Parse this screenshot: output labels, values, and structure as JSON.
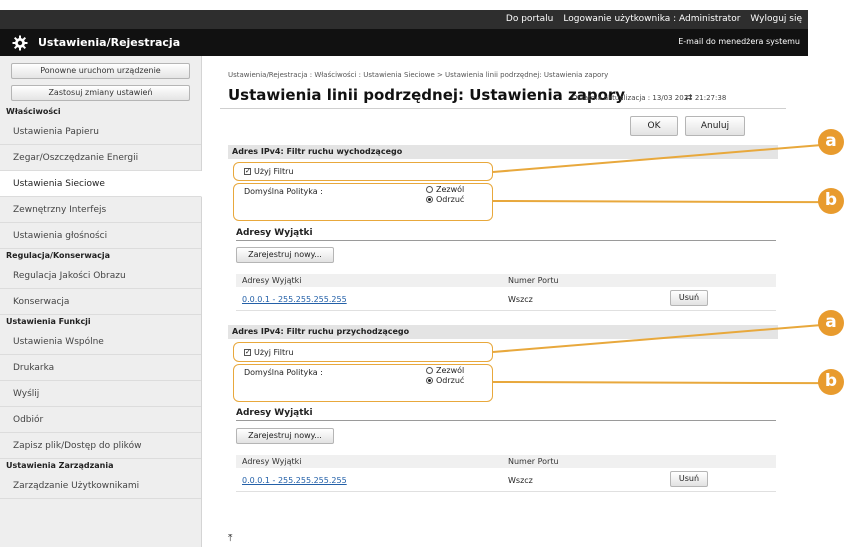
{
  "topbar": {
    "portal_link": "Do portalu",
    "login_user": "Logowanie użytkownika :",
    "user_name": "Administrator",
    "logout": "Wyloguj się"
  },
  "app": {
    "title": "Ustawienia/Rejestracja",
    "mail_link": "E-mail do menedżera systemu"
  },
  "sidebar": {
    "buttons": [
      "Ponowne uruchom urządzenie",
      "Zastosuj zmiany ustawień"
    ],
    "categories": {
      "properties": "Właściwości",
      "adjust": "Regulacja/Konserwacja",
      "functions": "Ustawienia Funkcji",
      "management": "Ustawienia Zarządzania"
    },
    "items": [
      "Ustawienia Papieru",
      "Zegar/Oszczędzanie Energii",
      "Ustawienia Sieciowe",
      "Zewnętrzny Interfejs",
      "Ustawienia głośności",
      "Regulacja Jakości Obrazu",
      "Konserwacja",
      "Ustawienia Wspólne",
      "Drukarka",
      "Wyślij",
      "Odbiór",
      "Zapisz plik/Dostęp do plików",
      "Zarządzanie Użytkownikami"
    ]
  },
  "main": {
    "breadcrumb": "Ustawienia/Rejestracja : Właściwości : Ustawienia Sieciowe > Ustawienia linii podrzędnej: Ustawienia zapory",
    "title": "Ustawienia linii podrzędnej: Ustawienia zapory",
    "last_update": "Ostatnia aktualizacja : 13/03 2021 21:27:38",
    "ok_label": "OK",
    "cancel_label": "Anuluj",
    "sections": [
      {
        "header": "Adres IPv4: Filtr ruchu wychodzącego",
        "use_filter": "Użyj Filtru",
        "policy_label": "Domyślna Polityka :",
        "allow": "Zezwól",
        "deny": "Odrzuć",
        "exceptions_title": "Adresy Wyjątki",
        "register_new": "Zarejestruj nowy...",
        "col_addresses": "Adresy Wyjątki",
        "col_port": "Numer Portu",
        "rows": [
          {
            "address": "0.0.0.1 - 255.255.255.255",
            "port": "Wszcz",
            "delete": "Usuń"
          }
        ]
      },
      {
        "header": "Adres IPv4: Filtr ruchu przychodzącego",
        "use_filter": "Użyj Filtru",
        "policy_label": "Domyślna Polityka :",
        "allow": "Zezwól",
        "deny": "Odrzuć",
        "exceptions_title": "Adresy Wyjątki",
        "register_new": "Zarejestruj nowy...",
        "col_addresses": "Adresy Wyjątki",
        "col_port": "Numer Portu",
        "rows": [
          {
            "address": "0.0.0.1 - 255.255.255.255",
            "port": "Wszcz",
            "delete": "Usuń"
          }
        ]
      }
    ]
  },
  "callouts": {
    "a": "a",
    "b": "b"
  },
  "colors": {
    "callout": "#e8a83c",
    "header_dark": "#111111",
    "link": "#2360a8"
  }
}
